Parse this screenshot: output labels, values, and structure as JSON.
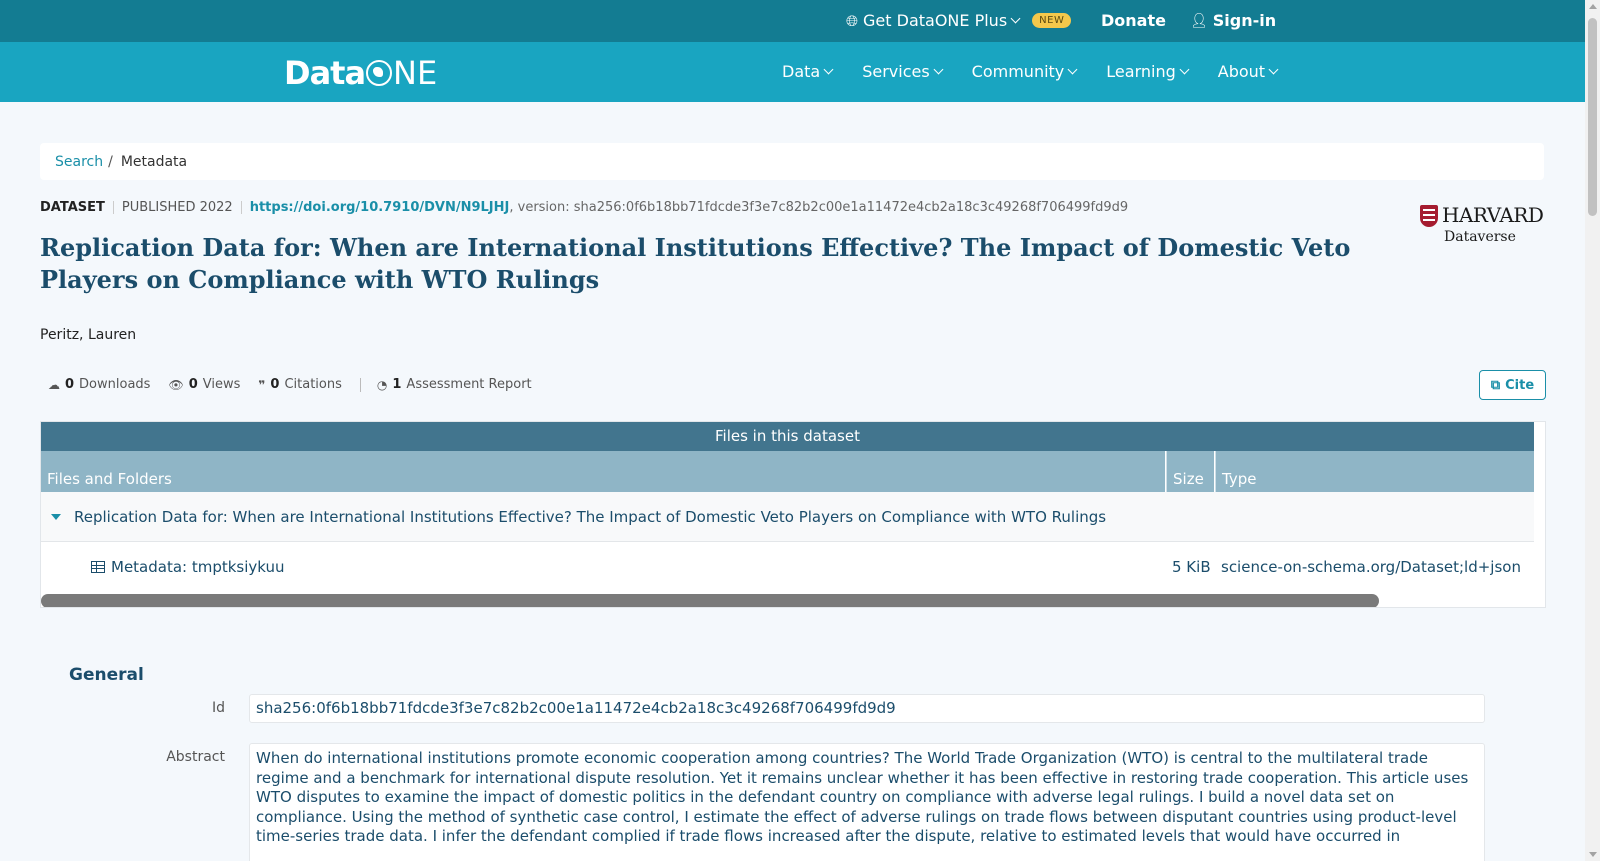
{
  "topbar": {
    "plus_label": "Get DataONE Plus",
    "new_badge": "NEW",
    "donate_label": "Donate",
    "signin_label": "Sign-in"
  },
  "brand": {
    "logo_data": "Data",
    "logo_o": "",
    "logo_ne": "NE",
    "primary_color": "#19a5c1",
    "dark_color": "#137c92"
  },
  "nav": {
    "items": [
      {
        "label": "Data"
      },
      {
        "label": "Services"
      },
      {
        "label": "Community"
      },
      {
        "label": "Learning"
      },
      {
        "label": "About"
      }
    ]
  },
  "breadcrumb": {
    "search": "Search",
    "separator": "/",
    "current": "Metadata"
  },
  "dataset": {
    "type": "DATASET",
    "published": "PUBLISHED 2022",
    "doi": "https://doi.org/10.7910/DVN/N9LJHJ",
    "version": ", version: sha256:0f6b18bb71fdcde3f3e7c82b2c00e1a11472e4cb2a18c3c49268f706499fd9d9",
    "title": "Replication Data for: When are International Institutions Effective? The Impact of Domestic Veto Players on Compliance with WTO Rulings",
    "author": "Peritz, Lauren"
  },
  "repository": {
    "name": "HARVARD",
    "sub": "Dataverse"
  },
  "stats": {
    "downloads_count": "0",
    "downloads_label": "Downloads",
    "views_count": "0",
    "views_label": "Views",
    "citations_count": "0",
    "citations_label": "Citations",
    "assessment_count": "1",
    "assessment_label": "Assessment Report"
  },
  "cite_label": "Cite",
  "files_table": {
    "header": "Files in this dataset",
    "columns": {
      "files": "Files and Folders",
      "size": "Size",
      "type": "Type"
    },
    "folder": "Replication Data for: When are International Institutions Effective? The Impact of Domestic Veto Players on Compliance with WTO Rulings",
    "file": {
      "name": "Metadata: tmptksiykuu",
      "size": "5 KiB",
      "type": "science-on-schema.org/Dataset;ld+json"
    }
  },
  "general": {
    "title": "General",
    "id_label": "Id",
    "id_value": "sha256:0f6b18bb71fdcde3f3e7c82b2c00e1a11472e4cb2a18c3c49268f706499fd9d9",
    "abstract_label": "Abstract",
    "abstract_value": "When do international institutions promote economic cooperation among countries? The World Trade Organization (WTO) is central to the multilateral trade regime and a benchmark for international dispute resolution. Yet it remains unclear whether it has been effective in restoring trade cooperation. This article uses WTO disputes to examine the impact of domestic politics in the defendant country on compliance with adverse legal rulings. I build a novel data set on compliance. Using the method of synthetic case control, I estimate the effect of adverse rulings on trade flows between disputant countries using product-level time-series trade data. I infer the defendant complied if trade flows increased after the dispute, relative to estimated levels that would have occurred in"
  }
}
